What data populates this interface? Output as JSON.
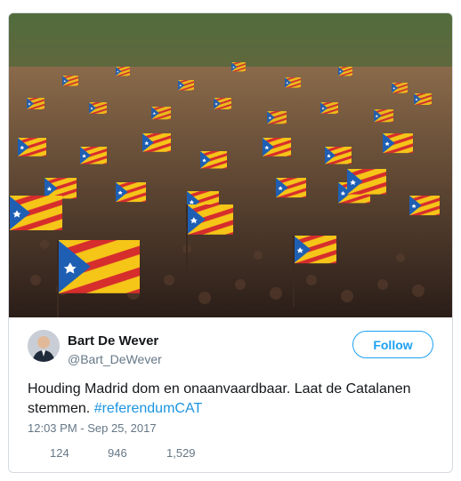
{
  "author": {
    "name": "Bart De Wever",
    "handle": "@Bart_DeWever"
  },
  "follow_button": {
    "label": "Follow"
  },
  "tweet": {
    "text": "Houding Madrid dom en onaanvaardbaar. Laat de Catalanen stemmen. ",
    "hashtag": "#referendumCAT",
    "timestamp": "12:03 PM - Sep 25, 2017"
  },
  "stats": {
    "replies": "124",
    "retweets": "946",
    "likes": "1,529"
  },
  "colors": {
    "accent": "#1da1f2",
    "hashtag": "#1b95e0",
    "flag_yellow": "#f5c518",
    "flag_red": "#d62d2d",
    "flag_blue": "#1e5fb4"
  },
  "photo": {
    "subject": "estelada-flags-crowd"
  }
}
